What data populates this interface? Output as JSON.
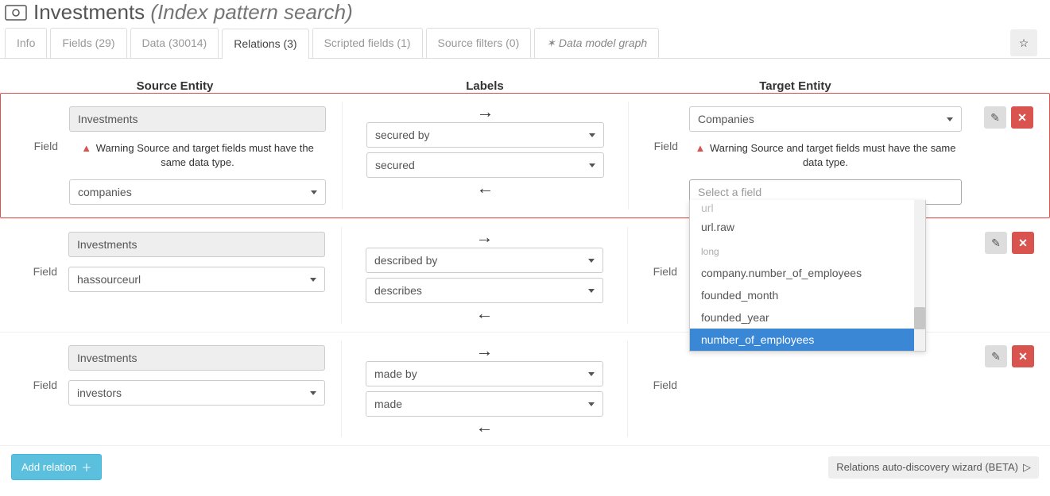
{
  "header": {
    "title": "Investments",
    "subtitle": "(Index pattern search)"
  },
  "tabs": [
    {
      "label": "Info"
    },
    {
      "label": "Fields (29)"
    },
    {
      "label": "Data (30014)"
    },
    {
      "label": "Relations (3)",
      "active": true
    },
    {
      "label": "Scripted fields (1)"
    },
    {
      "label": "Source filters (0)"
    },
    {
      "label": "Data model graph",
      "icon": true
    }
  ],
  "columns": {
    "source": "Source Entity",
    "labels": "Labels",
    "target": "Target Entity"
  },
  "field_label": "Field",
  "warning_text": "Warning Source and target fields must have the same data type.",
  "relations": [
    {
      "error": true,
      "source_entity": "Investments",
      "source_field": "companies",
      "source_warning": true,
      "label_forward": "secured by",
      "label_back": "secured",
      "target_entity": "Companies",
      "target_warning": true,
      "target_field_placeholder": "Select a field",
      "target_field_dropdown_open": true
    },
    {
      "source_entity": "Investments",
      "source_field": "hassourceurl",
      "label_forward": "described by",
      "label_back": "describes"
    },
    {
      "source_entity": "Investments",
      "source_field": "investors",
      "label_forward": "made by",
      "label_back": "made"
    }
  ],
  "dropdown": {
    "items": [
      {
        "label": "url",
        "cut": true
      },
      {
        "label": "url.raw"
      },
      {
        "label": "long",
        "group": true
      },
      {
        "label": "company.number_of_employees"
      },
      {
        "label": "founded_month"
      },
      {
        "label": "founded_year"
      },
      {
        "label": "number_of_employees",
        "highlighted": true
      }
    ]
  },
  "footer": {
    "add": "Add relation",
    "wizard": "Relations auto-discovery wizard (BETA)"
  }
}
